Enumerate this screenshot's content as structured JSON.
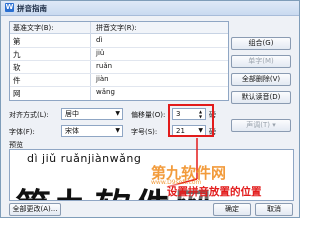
{
  "window": {
    "title": "拼音指南"
  },
  "grid": {
    "col_text": "基准文字(B):",
    "col_pinyin": "拼音文字(R):",
    "rows": [
      {
        "ch": "第",
        "py": "dì"
      },
      {
        "ch": "九",
        "py": "jiǔ"
      },
      {
        "ch": "软",
        "py": "ruǎn"
      },
      {
        "ch": "件",
        "py": "jiàn"
      },
      {
        "ch": "网",
        "py": "wǎng"
      }
    ]
  },
  "buttons": {
    "group": "组合(G)",
    "single": "单字(M)",
    "clear_all": "全部删除(V)",
    "default": "默认读音(D)",
    "ok": "确定",
    "cancel": "取消",
    "clear_all_bottom": "全部更改(A)...",
    "pinyin_lookup": "声调(T)"
  },
  "controls": {
    "align_label": "对齐方式(L):",
    "align_value": "居中",
    "offset_label": "偏移量(O):",
    "offset_value": "3",
    "offset_unit": "磅",
    "font_label": "字体(F):",
    "font_value": "宋体",
    "size_label": "字号(S):",
    "size_value": "21",
    "size_unit": "磅"
  },
  "preview": {
    "label": "预览",
    "pinyin": "dì  jiǔ ruǎnjiànwǎng",
    "text": "第九软件网"
  },
  "annotation": "设置拼音放置的位置",
  "watermark": {
    "line1": "第九软件网",
    "line2": "www.D9soft.com"
  },
  "colors": {
    "annotation": "#e21b1b",
    "watermark": "#f08a1a"
  }
}
